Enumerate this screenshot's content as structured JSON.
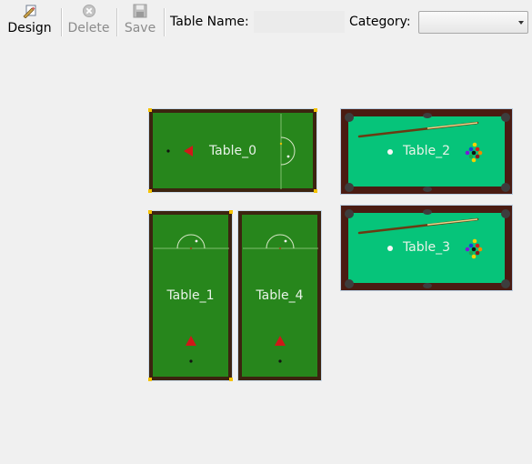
{
  "toolbar": {
    "design_label": "Design",
    "delete_label": "Delete",
    "save_label": "Save",
    "table_name_label": "Table Name:",
    "table_name_value": "",
    "category_label": "Category:",
    "category_value": ""
  },
  "icons": {
    "design": "design-edit-icon",
    "delete": "delete-circle-x-icon",
    "save": "floppy-disk-icon"
  },
  "tables": [
    {
      "name": "Table_0",
      "type": "snooker"
    },
    {
      "name": "Table_1",
      "type": "snooker"
    },
    {
      "name": "Table_2",
      "type": "pool"
    },
    {
      "name": "Table_3",
      "type": "pool"
    },
    {
      "name": "Table_4",
      "type": "snooker"
    }
  ],
  "colors": {
    "snooker_cloth": "#27861c",
    "pool_cloth": "#06c47a",
    "wood": "#4a1b12",
    "selection_handle": "#f4c200"
  }
}
